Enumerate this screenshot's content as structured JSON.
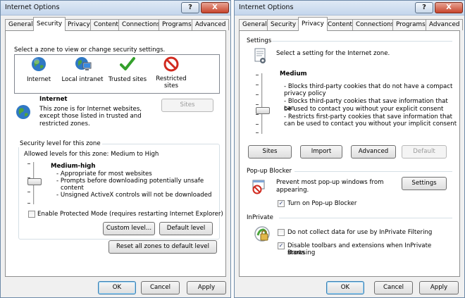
{
  "left_window": {
    "title": "Internet Options",
    "help_glyph": "?",
    "close_glyph": "X",
    "tabs": [
      "General",
      "Security",
      "Privacy",
      "Content",
      "Connections",
      "Programs",
      "Advanced"
    ],
    "active_tab": "Security",
    "zone_prompt": "Select a zone to view or change security settings.",
    "zones": [
      {
        "label": "Internet",
        "icon": "globe-icon"
      },
      {
        "label": "Local intranet",
        "icon": "network-computer-icon"
      },
      {
        "label": "Trusted sites",
        "icon": "checkmark-icon"
      },
      {
        "label": "Restricted",
        "label2": "sites",
        "icon": "restricted-icon"
      }
    ],
    "zone_info": {
      "name": "Internet",
      "desc1": "This zone is for Internet websites,",
      "desc2": "except those listed in trusted and",
      "desc3": "restricted zones.",
      "sites_button": "Sites"
    },
    "security_level": {
      "group_title": "Security level for this zone",
      "allowed": "Allowed levels for this zone: Medium to High",
      "level_name": "Medium-high",
      "bullets": [
        "- Appropriate for most websites",
        "- Prompts before downloading potentially unsafe",
        "content",
        "- Unsigned ActiveX controls will not be downloaded"
      ],
      "protected_mode": "Enable Protected Mode (requires restarting Internet Explorer)",
      "protected_mode_checked": false,
      "custom_level_button": "Custom level...",
      "default_level_button": "Default level"
    },
    "reset_all_button": "Reset all zones to default level",
    "footer": {
      "ok": "OK",
      "cancel": "Cancel",
      "apply": "Apply"
    }
  },
  "right_window": {
    "title": "Internet Options",
    "help_glyph": "?",
    "close_glyph": "X",
    "tabs": [
      "General",
      "Security",
      "Privacy",
      "Content",
      "Connections",
      "Programs",
      "Advanced"
    ],
    "active_tab": "Privacy",
    "settings": {
      "section_title": "Settings",
      "prompt": "Select a setting for the Internet zone.",
      "level_name": "Medium",
      "bullets": [
        "- Blocks third-party cookies that do not have a compact",
        "privacy policy",
        "- Blocks third-party cookies that save information that can",
        "be used to contact you without your explicit consent",
        "- Restricts first-party cookies that save information that",
        "can be used to contact you without your implicit consent"
      ],
      "buttons": [
        "Sites",
        "Import",
        "Advanced",
        "Default"
      ]
    },
    "popup": {
      "section_title": "Pop-up Blocker",
      "desc1": "Prevent most pop-up windows from",
      "desc2": "appearing.",
      "settings_button": "Settings",
      "turn_on_label": "Turn on Pop-up Blocker",
      "turn_on_checked": true
    },
    "inprivate": {
      "section_title": "InPrivate",
      "no_collect_label": "Do not collect data for use by InPrivate Filtering",
      "no_collect_checked": false,
      "disable_toolbars_label1": "Disable toolbars and extensions when InPrivate Browsing",
      "disable_toolbars_label2": "starts",
      "disable_toolbars_checked": true
    },
    "footer": {
      "ok": "OK",
      "cancel": "Cancel",
      "apply": "Apply"
    }
  },
  "colors": {
    "accent_button_border": "#3c7fb1",
    "close_button_red": "#c8452c",
    "panel_border": "#8e8f8f"
  }
}
